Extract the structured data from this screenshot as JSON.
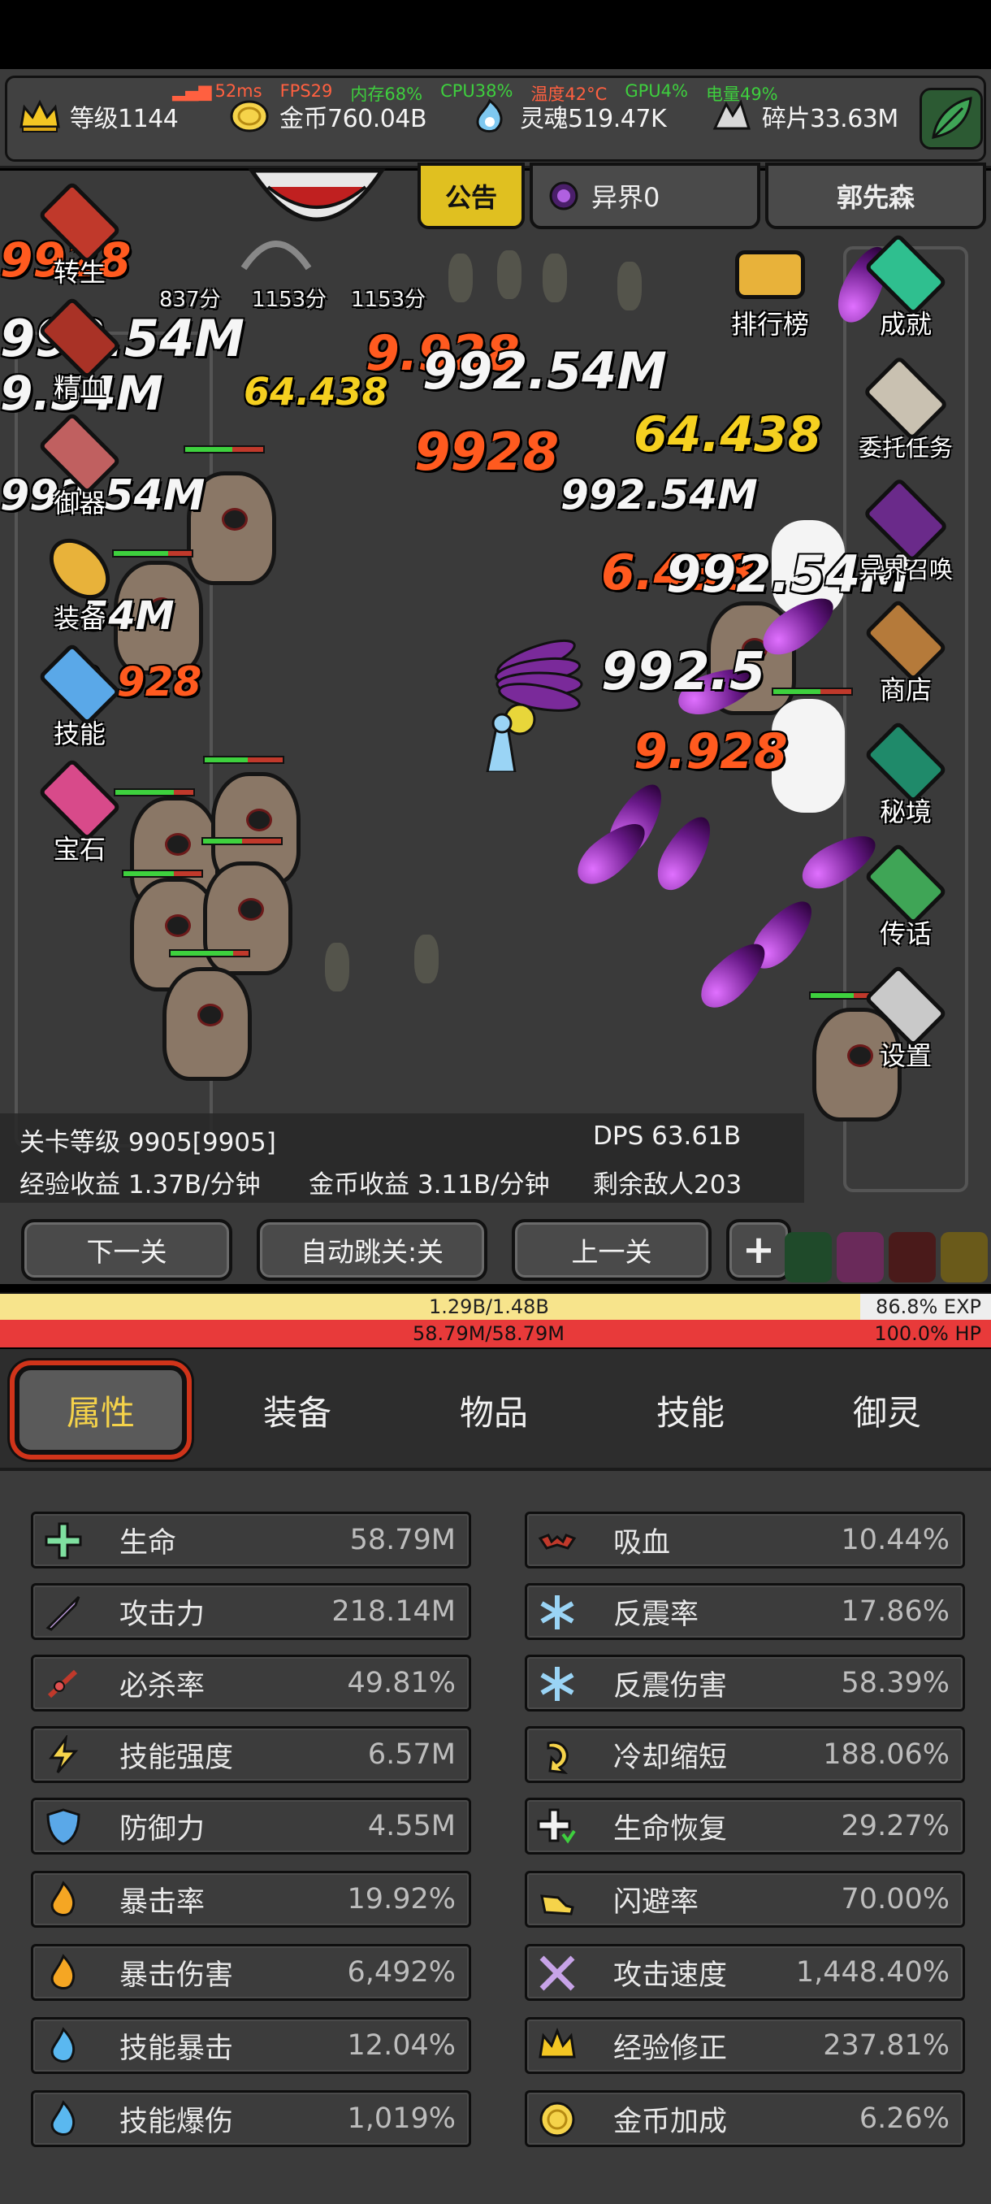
{
  "status": {
    "ping": "52ms",
    "fps": "FPS29",
    "memory": "内存68%",
    "cpu": "CPU38%",
    "temperature": "温度42°C",
    "gpu": "GPU4%",
    "battery": "电量49%",
    "colors": {
      "ping": "#ff6040",
      "fps": "#ff6040",
      "memory": "#3ecf3e",
      "cpu": "#3ecf3e",
      "temperature": "#ff6040",
      "gpu": "#3ecf3e",
      "battery": "#3ecf3e"
    }
  },
  "resources": {
    "level": "等级1144",
    "gold": "金币760.04B",
    "soul": "灵魂519.47K",
    "shard": "碎片33.63M"
  },
  "banner": {
    "notice": "公告",
    "otherworld": "异界0",
    "player_name": "郭先森"
  },
  "left_menu": {
    "rebirth": "转生",
    "essence": "精血",
    "spirit_weapon": "御器",
    "equipment": "装备",
    "skills": "技能",
    "gems": "宝石"
  },
  "right_menu": {
    "leaderboard": "排行榜",
    "achievements": "成就",
    "quests": "委托任务",
    "summon": "异界召唤",
    "shop": "商店",
    "secret_realm": "秘境",
    "message": "传话",
    "settings": "设置"
  },
  "score_labels": [
    "837分",
    "1153分",
    "1153分"
  ],
  "damage_numbers": {
    "big_white": "992.54M",
    "big_white_2": "992.54M",
    "orange_1": "9.928",
    "yellow_1": "64.438",
    "orange_2": "9928",
    "white_partial_1": "9.54M",
    "white_partial_2": "54M",
    "yellow_2": "64.438",
    "white_3": "992.54M",
    "orange_3": "6.438",
    "white_4": "992.5",
    "orange_4": "9.928"
  },
  "stage": {
    "stage_level": "关卡等级 9905[9905]",
    "dps": "DPS 63.61B",
    "exp_rate": "经验收益 1.37B/分钟",
    "gold_rate": "金币收益 3.11B/分钟",
    "enemies_left": "剩余敌人203"
  },
  "nav_buttons": {
    "next": "下一关",
    "auto_skip": "自动跳关:关",
    "prev": "上一关",
    "plus": "+"
  },
  "bars": {
    "exp_text": "1.29B/1.48B",
    "exp_percent_text": "86.8% EXP",
    "exp_fraction": 0.868,
    "hp_text": "58.79M/58.79M",
    "hp_percent_text": "100.0%  HP",
    "hp_fraction": 1.0
  },
  "tabs": [
    "属性",
    "装备",
    "物品",
    "技能",
    "御灵"
  ],
  "stats_left": [
    {
      "name": "生命",
      "value": "58.79M",
      "icon": "health-cross-icon"
    },
    {
      "name": "攻击力",
      "value": "218.14M",
      "icon": "sword-icon"
    },
    {
      "name": "必杀率",
      "value": "49.81%",
      "icon": "crit-burst-icon"
    },
    {
      "name": "技能强度",
      "value": "6.57M",
      "icon": "lightning-icon"
    },
    {
      "name": "防御力",
      "value": "4.55M",
      "icon": "shield-icon"
    },
    {
      "name": "暴击率",
      "value": "19.92%",
      "icon": "fire-icon"
    },
    {
      "name": "暴击伤害",
      "value": "6,492%",
      "icon": "fire-icon"
    },
    {
      "name": "技能暴击",
      "value": "12.04%",
      "icon": "blue-fire-icon"
    },
    {
      "name": "技能爆伤",
      "value": "1,019%",
      "icon": "blue-fire-icon"
    }
  ],
  "stats_right": [
    {
      "name": "吸血",
      "value": "10.44%",
      "icon": "bat-icon"
    },
    {
      "name": "反震率",
      "value": "17.86%",
      "icon": "snowflake-icon"
    },
    {
      "name": "反震伤害",
      "value": "58.39%",
      "icon": "snowflake-icon"
    },
    {
      "name": "冷却缩短",
      "value": "188.06%",
      "icon": "cooldown-arrow-icon"
    },
    {
      "name": "生命恢复",
      "value": "29.27%",
      "icon": "regen-cross-icon"
    },
    {
      "name": "闪避率",
      "value": "70.00%",
      "icon": "winged-boot-icon"
    },
    {
      "name": "攻击速度",
      "value": "1,448.40%",
      "icon": "crossed-swords-icon"
    },
    {
      "name": "经验修正",
      "value": "237.81%",
      "icon": "crown-icon"
    },
    {
      "name": "金币加成",
      "value": "6.26%",
      "icon": "gold-coin-icon"
    }
  ]
}
